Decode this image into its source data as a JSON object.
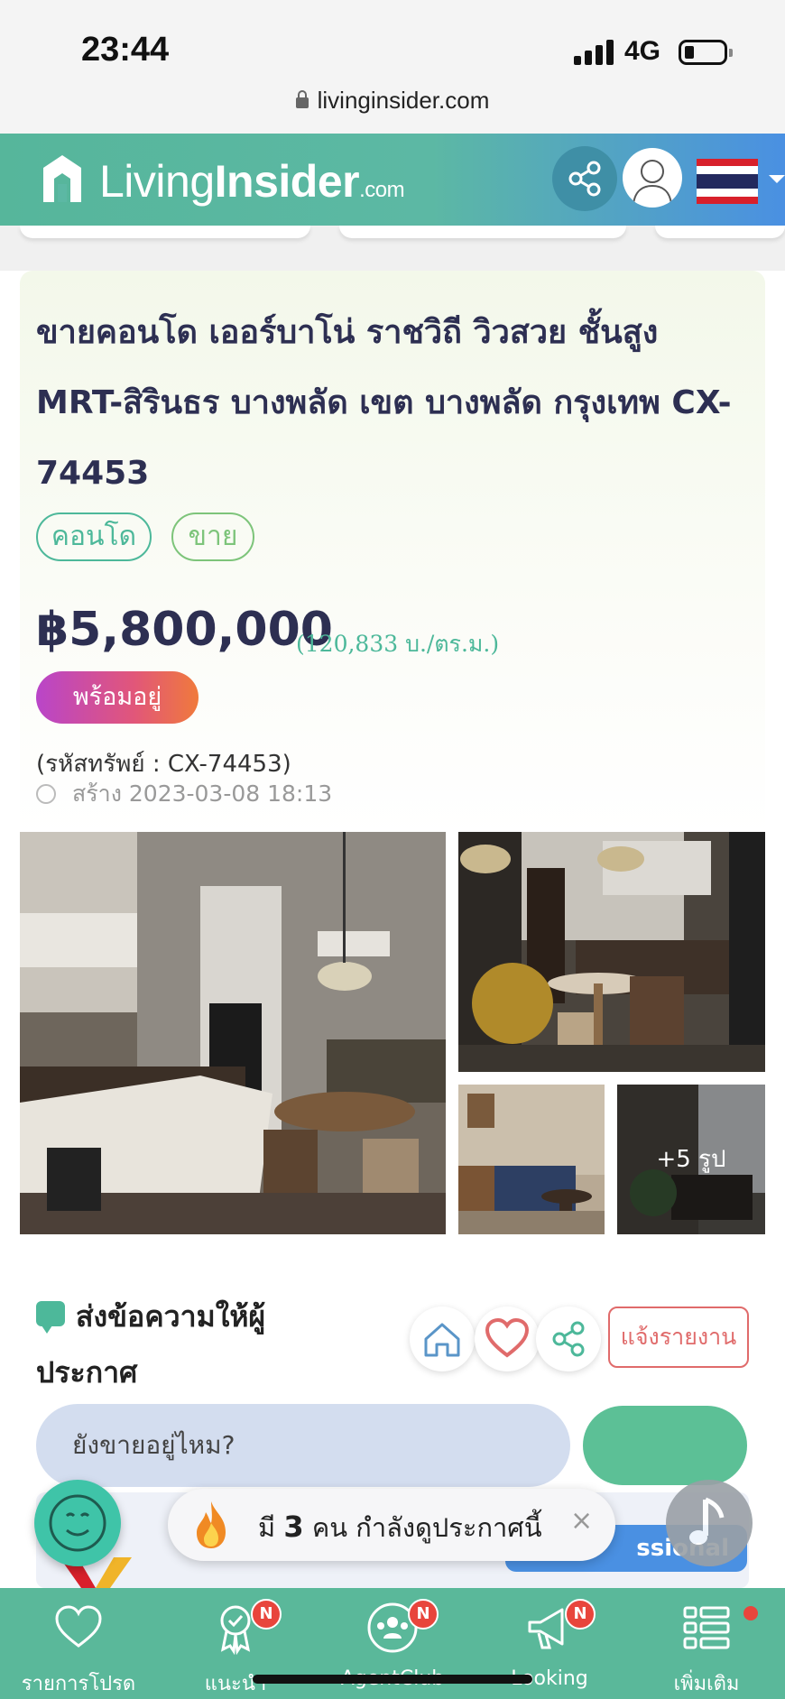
{
  "status_bar": {
    "time": "23:44",
    "network": "4G",
    "url": "livinginsider.com"
  },
  "header": {
    "logo_living": "Living",
    "logo_insider": "Insider",
    "logo_suffix": ".com"
  },
  "listing": {
    "title": "ขายคอนโด เออร์บาโน่ ราชวิถี วิวสวย ชั้นสูง MRT-สิรินธร บางพลัด เขต บางพลัด กรุงเทพ CX-74453",
    "tags": [
      "คอนโด",
      "ขาย"
    ],
    "price": "฿5,800,000",
    "price_per_sqm": "(120,833 บ./ตร.ม.)",
    "status": "พร้อมอยู่",
    "property_code": "(รหัสทรัพย์ : CX-74453)",
    "created": "สร้าง 2023-03-08 18:13",
    "more_photos": "+5 รูป"
  },
  "message": {
    "title": "ส่งข้อความให้ผู้ประกาศ",
    "input_value": "ยังขายอยู่ไหม?",
    "report_label": "แจ้งรายงาน"
  },
  "overlay": {
    "viewers_prefix": "มี",
    "viewers_count": "3",
    "viewers_suffix": "คน กำลังดูประกาศนี้",
    "close": "×",
    "pro_label": "ssional"
  },
  "bottom_nav": {
    "items": [
      {
        "label": "รายการโปรด",
        "icon": "heart-icon",
        "badge": ""
      },
      {
        "label": "แนะนำ",
        "icon": "award-icon",
        "badge": "N"
      },
      {
        "label": "AgentClub",
        "icon": "agent-group-icon",
        "badge": "N"
      },
      {
        "label": "Looking",
        "icon": "megaphone-icon",
        "badge": "N"
      },
      {
        "label": "เพิ่มเติม",
        "icon": "menu-grid-icon",
        "badge": ""
      }
    ]
  },
  "colors": {
    "brand_green": "#5ab89a",
    "title_navy": "#2d2f52",
    "report_red": "#e06b6b",
    "accent_blue": "#4a90e2"
  }
}
